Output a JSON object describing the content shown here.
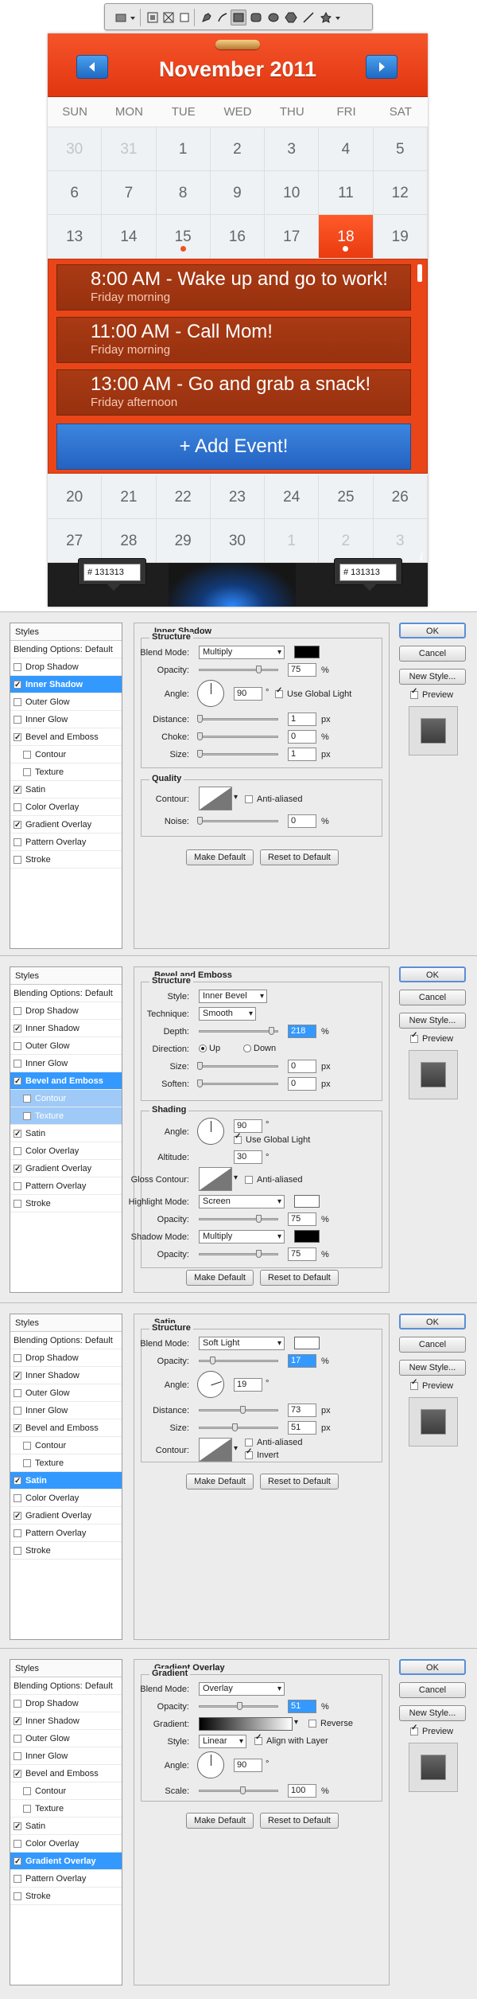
{
  "calendar": {
    "title": "November 2011",
    "days": [
      "SUN",
      "MON",
      "TUE",
      "WED",
      "THU",
      "FRI",
      "SAT"
    ],
    "weeks_top": [
      [
        "30",
        "31",
        "1",
        "2",
        "3",
        "4",
        "5"
      ],
      [
        "6",
        "7",
        "8",
        "9",
        "10",
        "11",
        "12"
      ],
      [
        "13",
        "14",
        "15",
        "16",
        "17",
        "18",
        "19"
      ]
    ],
    "weeks_bottom": [
      [
        "20",
        "21",
        "22",
        "23",
        "24",
        "25",
        "26"
      ],
      [
        "27",
        "28",
        "29",
        "30",
        "1",
        "2",
        "3"
      ]
    ],
    "events": [
      {
        "time": "8:00 AM - Wake up and go to work!",
        "sub": "Friday morning"
      },
      {
        "time": "11:00 AM - Call Mom!",
        "sub": "Friday morning"
      },
      {
        "time": "13:00 AM - Go  and grab a snack!",
        "sub": "Friday afternoon"
      }
    ],
    "add_event": "+ Add Event!",
    "hex_left": "#  131313",
    "hex_right": "#  131313",
    "info": "i"
  },
  "styles_list": {
    "header": "Styles",
    "items": [
      "Blending Options: Default",
      "Drop Shadow",
      "Inner Shadow",
      "Outer Glow",
      "Inner Glow",
      "Bevel and Emboss",
      "Contour",
      "Texture",
      "Satin",
      "Color Overlay",
      "Gradient Overlay",
      "Pattern Overlay",
      "Stroke"
    ]
  },
  "buttons": {
    "ok": "OK",
    "cancel": "Cancel",
    "new_style": "New Style...",
    "preview": "Preview",
    "make_default": "Make Default",
    "reset_default": "Reset to Default"
  },
  "inner_shadow": {
    "title": "Inner Shadow",
    "structure": "Structure",
    "blend_label": "Blend Mode:",
    "blend": "Multiply",
    "opacity_label": "Opacity:",
    "opacity": "75",
    "angle_label": "Angle:",
    "angle": "90",
    "global": "Use Global Light",
    "distance_label": "Distance:",
    "distance": "1",
    "choke_label": "Choke:",
    "choke": "0",
    "size_label": "Size:",
    "size": "1",
    "quality": "Quality",
    "contour_label": "Contour:",
    "anti": "Anti-aliased",
    "noise_label": "Noise:",
    "noise": "0"
  },
  "bevel": {
    "title": "Bevel and Emboss",
    "structure": "Structure",
    "style_label": "Style:",
    "style": "Inner Bevel",
    "tech_label": "Technique:",
    "tech": "Smooth",
    "depth_label": "Depth:",
    "depth": "218",
    "dir_label": "Direction:",
    "up": "Up",
    "down": "Down",
    "size_label": "Size:",
    "size": "0",
    "soften_label": "Soften:",
    "soften": "0",
    "shading": "Shading",
    "angle_label": "Angle:",
    "angle": "90",
    "global": "Use Global Light",
    "alt_label": "Altitude:",
    "alt": "30",
    "gloss_label": "Gloss Contour:",
    "anti": "Anti-aliased",
    "hl_label": "Highlight Mode:",
    "hl": "Screen",
    "hl_op_label": "Opacity:",
    "hl_op": "75",
    "sh_label": "Shadow Mode:",
    "sh": "Multiply",
    "sh_op_label": "Opacity:",
    "sh_op": "75"
  },
  "satin": {
    "title": "Satin",
    "structure": "Structure",
    "blend_label": "Blend Mode:",
    "blend": "Soft Light",
    "opacity_label": "Opacity:",
    "opacity": "17",
    "angle_label": "Angle:",
    "angle": "19",
    "distance_label": "Distance:",
    "distance": "73",
    "size_label": "Size:",
    "size": "51",
    "contour_label": "Contour:",
    "anti": "Anti-aliased",
    "invert": "Invert"
  },
  "gradient": {
    "title": "Gradient Overlay",
    "section": "Gradient",
    "blend_label": "Blend Mode:",
    "blend": "Overlay",
    "opacity_label": "Opacity:",
    "opacity": "51",
    "gradient_label": "Gradient:",
    "reverse": "Reverse",
    "style_label": "Style:",
    "style": "Linear",
    "align": "Align with Layer",
    "angle_label": "Angle:",
    "angle": "90",
    "scale_label": "Scale:",
    "scale": "100"
  },
  "units": {
    "pct": "%",
    "px": "px",
    "deg": "°"
  }
}
